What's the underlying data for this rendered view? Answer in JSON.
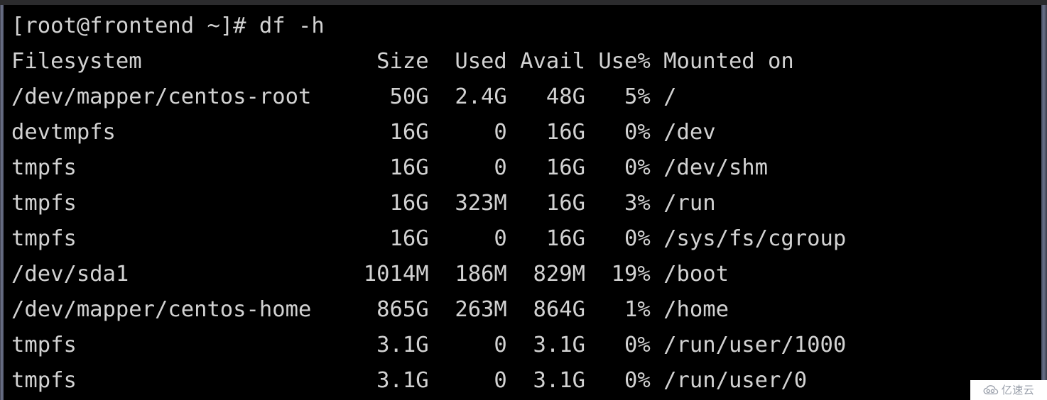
{
  "window": {
    "border_color": "#6e748c",
    "titlebar_color": "#2b2b2d",
    "background_color": "#000000",
    "text_color": "#d2d2d2"
  },
  "terminal": {
    "prompt_line": "[root@frontend ~]# df -h",
    "prompt": "[root@frontend ~]#",
    "command": "df -h",
    "user": "root",
    "hostname": "frontend",
    "cwd": "~",
    "columns": [
      "Filesystem",
      "Size",
      "Used",
      "Avail",
      "Use%",
      "Mounted on"
    ],
    "header_line": "Filesystem                  Size  Used Avail Use% Mounted on",
    "rows": [
      {
        "filesystem": "/dev/mapper/centos-root",
        "size": "50G",
        "used": "2.4G",
        "avail": "48G",
        "use_pct": "5%",
        "mounted_on": "/",
        "line": "/dev/mapper/centos-root      50G  2.4G   48G   5% /"
      },
      {
        "filesystem": "devtmpfs",
        "size": "16G",
        "used": "0",
        "avail": "16G",
        "use_pct": "0%",
        "mounted_on": "/dev",
        "line": "devtmpfs                     16G     0   16G   0% /dev"
      },
      {
        "filesystem": "tmpfs",
        "size": "16G",
        "used": "0",
        "avail": "16G",
        "use_pct": "0%",
        "mounted_on": "/dev/shm",
        "line": "tmpfs                        16G     0   16G   0% /dev/shm"
      },
      {
        "filesystem": "tmpfs",
        "size": "16G",
        "used": "323M",
        "avail": "16G",
        "use_pct": "3%",
        "mounted_on": "/run",
        "line": "tmpfs                        16G  323M   16G   3% /run"
      },
      {
        "filesystem": "tmpfs",
        "size": "16G",
        "used": "0",
        "avail": "16G",
        "use_pct": "0%",
        "mounted_on": "/sys/fs/cgroup",
        "line": "tmpfs                        16G     0   16G   0% /sys/fs/cgroup"
      },
      {
        "filesystem": "/dev/sda1",
        "size": "1014M",
        "used": "186M",
        "avail": "829M",
        "use_pct": "19%",
        "mounted_on": "/boot",
        "line": "/dev/sda1                  1014M  186M  829M  19% /boot"
      },
      {
        "filesystem": "/dev/mapper/centos-home",
        "size": "865G",
        "used": "263M",
        "avail": "864G",
        "use_pct": "1%",
        "mounted_on": "/home",
        "line": "/dev/mapper/centos-home     865G  263M  864G   1% /home"
      },
      {
        "filesystem": "tmpfs",
        "size": "3.1G",
        "used": "0",
        "avail": "3.1G",
        "use_pct": "0%",
        "mounted_on": "/run/user/1000",
        "line": "tmpfs                       3.1G     0  3.1G   0% /run/user/1000"
      },
      {
        "filesystem": "tmpfs",
        "size": "3.1G",
        "used": "0",
        "avail": "3.1G",
        "use_pct": "0%",
        "mounted_on": "/run/user/0",
        "line": "tmpfs                       3.1G     0  3.1G   0% /run/user/0"
      }
    ]
  },
  "watermark": {
    "text": "亿速云",
    "icon": "cloud-icon",
    "color": "#9aa0ab",
    "background": "#ffffff"
  }
}
